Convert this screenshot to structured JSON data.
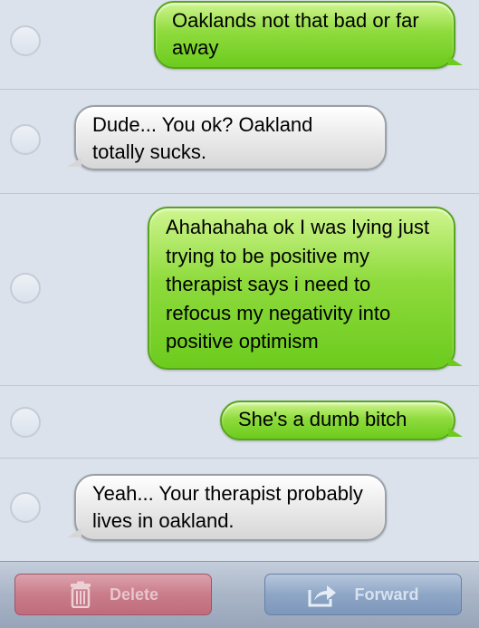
{
  "messages": [
    {
      "direction": "sent",
      "text": "Oaklands not that bad or far away"
    },
    {
      "direction": "received",
      "text": "Dude... You ok? Oakland totally sucks."
    },
    {
      "direction": "sent",
      "text": "Ahahahaha ok I was lying just trying to be positive my therapist says i need to refocus my negativity into positive optimism"
    },
    {
      "direction": "sent",
      "text": "She's a dumb bitch"
    },
    {
      "direction": "received",
      "text": "Yeah... Your therapist probably lives in oakland."
    }
  ],
  "toolbar": {
    "delete_label": "Delete",
    "delete_icon": "trash-icon",
    "forward_label": "Forward",
    "forward_icon": "share-arrow-icon"
  },
  "colors": {
    "sent_bubble": "#7ed12e",
    "received_bubble": "#e6e6e6",
    "background": "#dbe2ec",
    "delete_button": "#c97c8a",
    "forward_button": "#8ea6c6"
  }
}
